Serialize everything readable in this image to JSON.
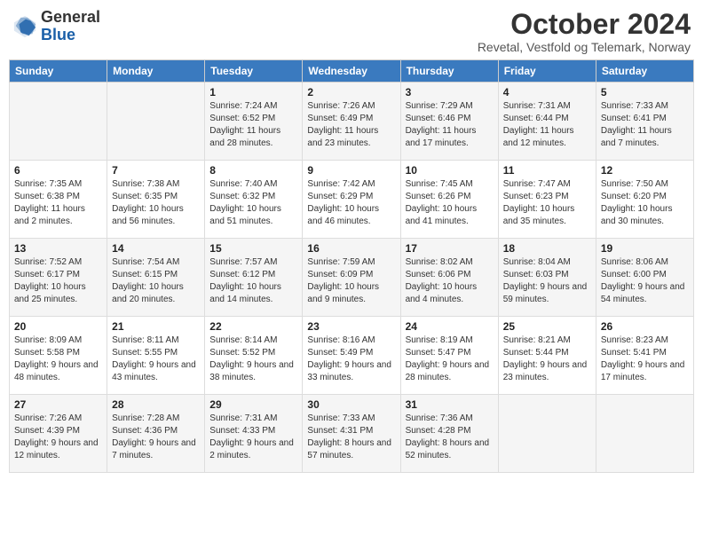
{
  "header": {
    "logo_line1": "General",
    "logo_line2": "Blue",
    "month": "October 2024",
    "location": "Revetal, Vestfold og Telemark, Norway"
  },
  "weekdays": [
    "Sunday",
    "Monday",
    "Tuesday",
    "Wednesday",
    "Thursday",
    "Friday",
    "Saturday"
  ],
  "weeks": [
    [
      {
        "day": "",
        "sunrise": "",
        "sunset": "",
        "daylight": ""
      },
      {
        "day": "",
        "sunrise": "",
        "sunset": "",
        "daylight": ""
      },
      {
        "day": "1",
        "sunrise": "Sunrise: 7:24 AM",
        "sunset": "Sunset: 6:52 PM",
        "daylight": "Daylight: 11 hours and 28 minutes."
      },
      {
        "day": "2",
        "sunrise": "Sunrise: 7:26 AM",
        "sunset": "Sunset: 6:49 PM",
        "daylight": "Daylight: 11 hours and 23 minutes."
      },
      {
        "day": "3",
        "sunrise": "Sunrise: 7:29 AM",
        "sunset": "Sunset: 6:46 PM",
        "daylight": "Daylight: 11 hours and 17 minutes."
      },
      {
        "day": "4",
        "sunrise": "Sunrise: 7:31 AM",
        "sunset": "Sunset: 6:44 PM",
        "daylight": "Daylight: 11 hours and 12 minutes."
      },
      {
        "day": "5",
        "sunrise": "Sunrise: 7:33 AM",
        "sunset": "Sunset: 6:41 PM",
        "daylight": "Daylight: 11 hours and 7 minutes."
      }
    ],
    [
      {
        "day": "6",
        "sunrise": "Sunrise: 7:35 AM",
        "sunset": "Sunset: 6:38 PM",
        "daylight": "Daylight: 11 hours and 2 minutes."
      },
      {
        "day": "7",
        "sunrise": "Sunrise: 7:38 AM",
        "sunset": "Sunset: 6:35 PM",
        "daylight": "Daylight: 10 hours and 56 minutes."
      },
      {
        "day": "8",
        "sunrise": "Sunrise: 7:40 AM",
        "sunset": "Sunset: 6:32 PM",
        "daylight": "Daylight: 10 hours and 51 minutes."
      },
      {
        "day": "9",
        "sunrise": "Sunrise: 7:42 AM",
        "sunset": "Sunset: 6:29 PM",
        "daylight": "Daylight: 10 hours and 46 minutes."
      },
      {
        "day": "10",
        "sunrise": "Sunrise: 7:45 AM",
        "sunset": "Sunset: 6:26 PM",
        "daylight": "Daylight: 10 hours and 41 minutes."
      },
      {
        "day": "11",
        "sunrise": "Sunrise: 7:47 AM",
        "sunset": "Sunset: 6:23 PM",
        "daylight": "Daylight: 10 hours and 35 minutes."
      },
      {
        "day": "12",
        "sunrise": "Sunrise: 7:50 AM",
        "sunset": "Sunset: 6:20 PM",
        "daylight": "Daylight: 10 hours and 30 minutes."
      }
    ],
    [
      {
        "day": "13",
        "sunrise": "Sunrise: 7:52 AM",
        "sunset": "Sunset: 6:17 PM",
        "daylight": "Daylight: 10 hours and 25 minutes."
      },
      {
        "day": "14",
        "sunrise": "Sunrise: 7:54 AM",
        "sunset": "Sunset: 6:15 PM",
        "daylight": "Daylight: 10 hours and 20 minutes."
      },
      {
        "day": "15",
        "sunrise": "Sunrise: 7:57 AM",
        "sunset": "Sunset: 6:12 PM",
        "daylight": "Daylight: 10 hours and 14 minutes."
      },
      {
        "day": "16",
        "sunrise": "Sunrise: 7:59 AM",
        "sunset": "Sunset: 6:09 PM",
        "daylight": "Daylight: 10 hours and 9 minutes."
      },
      {
        "day": "17",
        "sunrise": "Sunrise: 8:02 AM",
        "sunset": "Sunset: 6:06 PM",
        "daylight": "Daylight: 10 hours and 4 minutes."
      },
      {
        "day": "18",
        "sunrise": "Sunrise: 8:04 AM",
        "sunset": "Sunset: 6:03 PM",
        "daylight": "Daylight: 9 hours and 59 minutes."
      },
      {
        "day": "19",
        "sunrise": "Sunrise: 8:06 AM",
        "sunset": "Sunset: 6:00 PM",
        "daylight": "Daylight: 9 hours and 54 minutes."
      }
    ],
    [
      {
        "day": "20",
        "sunrise": "Sunrise: 8:09 AM",
        "sunset": "Sunset: 5:58 PM",
        "daylight": "Daylight: 9 hours and 48 minutes."
      },
      {
        "day": "21",
        "sunrise": "Sunrise: 8:11 AM",
        "sunset": "Sunset: 5:55 PM",
        "daylight": "Daylight: 9 hours and 43 minutes."
      },
      {
        "day": "22",
        "sunrise": "Sunrise: 8:14 AM",
        "sunset": "Sunset: 5:52 PM",
        "daylight": "Daylight: 9 hours and 38 minutes."
      },
      {
        "day": "23",
        "sunrise": "Sunrise: 8:16 AM",
        "sunset": "Sunset: 5:49 PM",
        "daylight": "Daylight: 9 hours and 33 minutes."
      },
      {
        "day": "24",
        "sunrise": "Sunrise: 8:19 AM",
        "sunset": "Sunset: 5:47 PM",
        "daylight": "Daylight: 9 hours and 28 minutes."
      },
      {
        "day": "25",
        "sunrise": "Sunrise: 8:21 AM",
        "sunset": "Sunset: 5:44 PM",
        "daylight": "Daylight: 9 hours and 23 minutes."
      },
      {
        "day": "26",
        "sunrise": "Sunrise: 8:23 AM",
        "sunset": "Sunset: 5:41 PM",
        "daylight": "Daylight: 9 hours and 17 minutes."
      }
    ],
    [
      {
        "day": "27",
        "sunrise": "Sunrise: 7:26 AM",
        "sunset": "Sunset: 4:39 PM",
        "daylight": "Daylight: 9 hours and 12 minutes."
      },
      {
        "day": "28",
        "sunrise": "Sunrise: 7:28 AM",
        "sunset": "Sunset: 4:36 PM",
        "daylight": "Daylight: 9 hours and 7 minutes."
      },
      {
        "day": "29",
        "sunrise": "Sunrise: 7:31 AM",
        "sunset": "Sunset: 4:33 PM",
        "daylight": "Daylight: 9 hours and 2 minutes."
      },
      {
        "day": "30",
        "sunrise": "Sunrise: 7:33 AM",
        "sunset": "Sunset: 4:31 PM",
        "daylight": "Daylight: 8 hours and 57 minutes."
      },
      {
        "day": "31",
        "sunrise": "Sunrise: 7:36 AM",
        "sunset": "Sunset: 4:28 PM",
        "daylight": "Daylight: 8 hours and 52 minutes."
      },
      {
        "day": "",
        "sunrise": "",
        "sunset": "",
        "daylight": ""
      },
      {
        "day": "",
        "sunrise": "",
        "sunset": "",
        "daylight": ""
      }
    ]
  ]
}
